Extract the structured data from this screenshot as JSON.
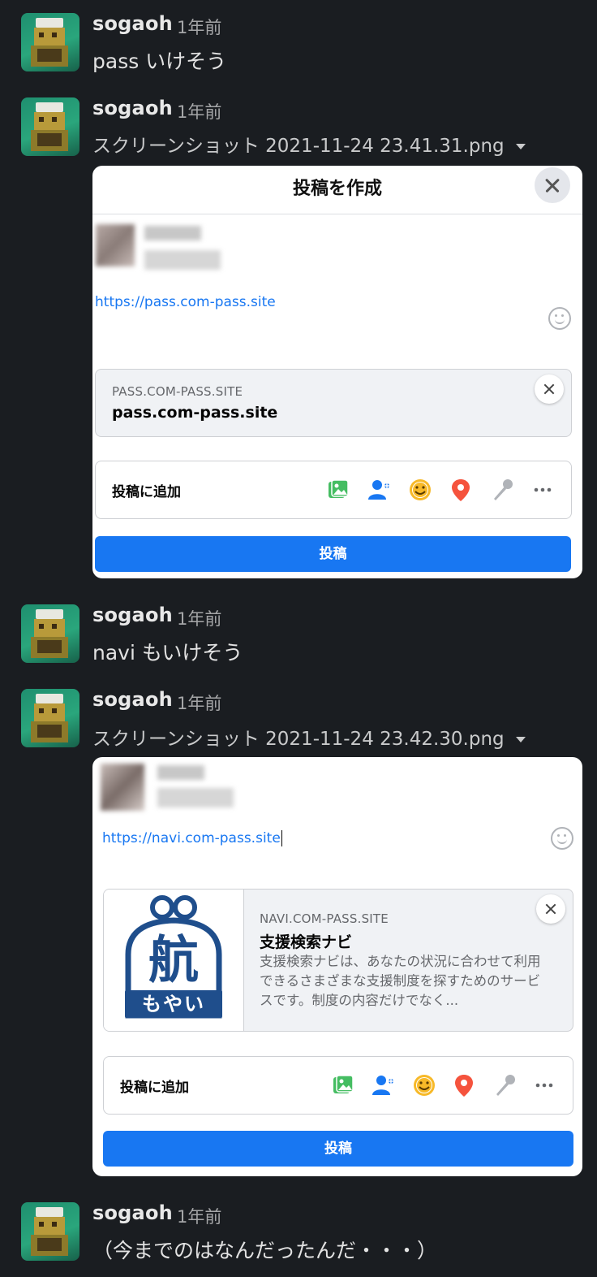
{
  "messages": [
    {
      "author": "sogaoh",
      "time": "1年前",
      "text": "pass いけそう"
    },
    {
      "author": "sogaoh",
      "time": "1年前",
      "file": "スクリーンショット 2021-11-24 23.41.31.png"
    },
    {
      "author": "sogaoh",
      "time": "1年前",
      "text": "navi もいけそう"
    },
    {
      "author": "sogaoh",
      "time": "1年前",
      "file": "スクリーンショット 2021-11-24 23.42.30.png"
    },
    {
      "author": "sogaoh",
      "time": "1年前",
      "text": "（今までのはなんだったんだ・・・）"
    }
  ],
  "shot1": {
    "title": "投稿を作成",
    "link": "https://pass.com-pass.site",
    "preview_domain": "PASS.COM-PASS.SITE",
    "preview_title": "pass.com-pass.site",
    "add_label": "投稿に追加",
    "post_label": "投稿"
  },
  "shot2": {
    "link": "https://navi.com-pass.site",
    "preview_domain": "NAVI.COM-PASS.SITE",
    "preview_title": "支援検索ナビ",
    "preview_desc": "支援検索ナビは、あなたの状況に合わせて利用できるさまざまな支援制度を探すためのサービスです。制度の内容だけでなく...",
    "logo_top": "航",
    "logo_bottom": "もやい",
    "add_label": "投稿に追加",
    "post_label": "投稿"
  },
  "icons": [
    "photo-icon",
    "tag-people-icon",
    "feeling-icon",
    "location-icon",
    "mic-icon",
    "more-icon"
  ],
  "colors": {
    "bg": "#1a1d21",
    "link": "#1877f2",
    "post_button": "#1877f2",
    "logo": "#1f4e8c"
  }
}
